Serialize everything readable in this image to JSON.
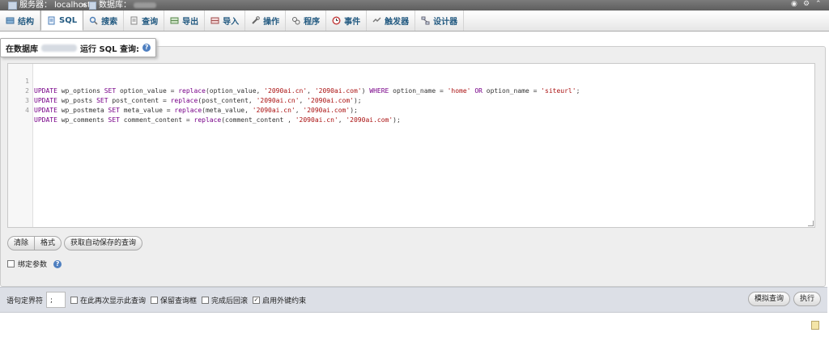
{
  "breadcrumb": {
    "server_label": "服务器：",
    "server_value": "localhost",
    "separator": "»",
    "database_label": "数据库："
  },
  "tabs": [
    {
      "label": "结构",
      "icon": "structure-icon"
    },
    {
      "label": "SQL",
      "icon": "sql-icon",
      "active": true
    },
    {
      "label": "搜索",
      "icon": "search-icon"
    },
    {
      "label": "查询",
      "icon": "query-icon"
    },
    {
      "label": "导出",
      "icon": "export-icon"
    },
    {
      "label": "导入",
      "icon": "import-icon"
    },
    {
      "label": "操作",
      "icon": "operations-icon"
    },
    {
      "label": "程序",
      "icon": "routines-icon"
    },
    {
      "label": "事件",
      "icon": "events-icon"
    },
    {
      "label": "触发器",
      "icon": "triggers-icon"
    },
    {
      "label": "设计器",
      "icon": "designer-icon"
    }
  ],
  "legend": {
    "prefix": "在数据库",
    "suffix": "运行 SQL 查询:"
  },
  "editor": {
    "lines": [
      "1",
      "2",
      "3",
      "4"
    ]
  },
  "buttons": {
    "clear": "清除",
    "format": "格式",
    "get_autosaved": "获取自动保存的查询"
  },
  "bind_params": {
    "label": "绑定参数"
  },
  "options": {
    "delimiter_label": "语句定界符",
    "delimiter_value": ";",
    "show_again": "在此再次显示此查询",
    "retain_box": "保留查询框",
    "rollback": "完成后回滚",
    "foreign_keys": "启用外键约束",
    "foreign_keys_checked": true
  },
  "actions": {
    "simulate": "模拟查询",
    "go": "执行"
  }
}
